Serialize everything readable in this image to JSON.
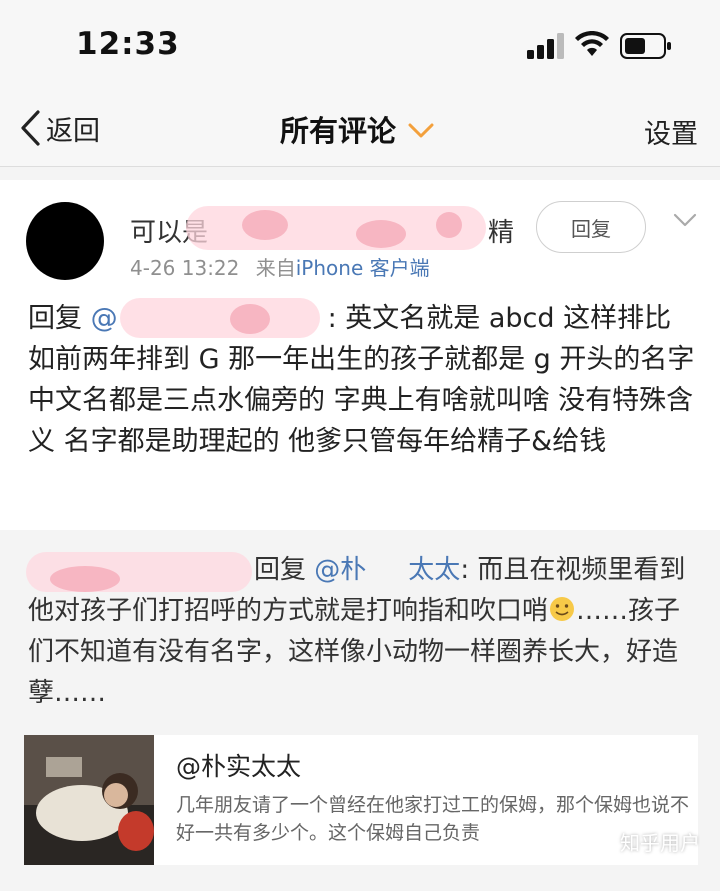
{
  "status_bar": {
    "time": "12:33"
  },
  "nav": {
    "back_label": "返回",
    "title": "所有评论",
    "settings_label": "设置"
  },
  "comment": {
    "username": "可以是",
    "username_tail": "精",
    "time": "4-26 13:22",
    "source_prefix": "来自",
    "source_device": "iPhone 客户端",
    "reply_button": "回复",
    "reply_prefix": "回复",
    "mention": "@",
    "body": ": 英文名就是 abcd 这样排比如前两年排到 G 那一年出生的孩子就都是 g 开头的名字 中文名都是三点水偏旁的 字典上有啥就叫啥 没有特殊含义 名字都是助理起的 他爹只管每年给精子&给钱"
  },
  "quoted": {
    "reply_prefix": "回复",
    "mention_start": "@朴",
    "mention_end": "太太",
    "text_line1": ": 而且在视频里看到他对孩子们打招呼的方式就是打响指和吹口哨",
    "text_line2": "……孩子们不知道有没有名字，这样像小动物一样圈养长大，好造孽……",
    "emoji": "face-emoji"
  },
  "repost": {
    "user": "@朴实太太",
    "text": "几年朋友请了一个曾经在他家打过工的保姆，那个保姆也说不好一共有多少个。这个保姆自己负责"
  },
  "watermark": "知乎用户",
  "colors": {
    "link": "#4a78b5",
    "accent_chevron": "#f3a03c",
    "page_bg": "#f4f4f4"
  }
}
